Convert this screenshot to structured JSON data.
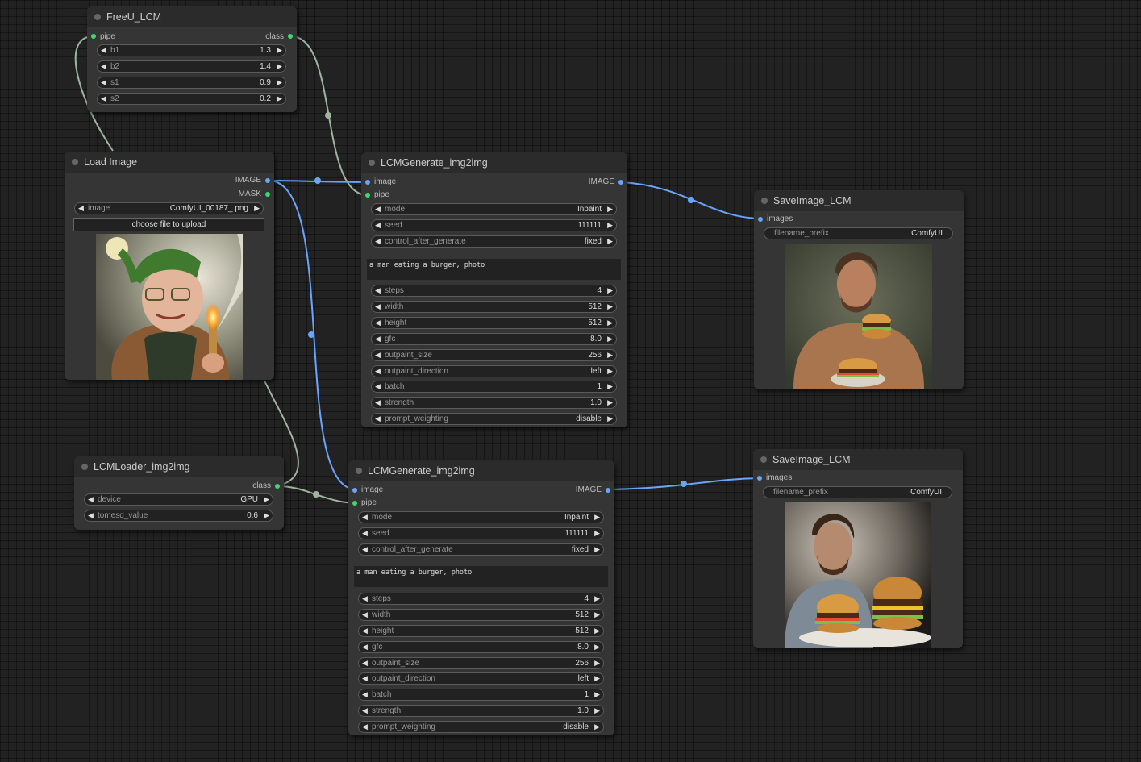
{
  "colors": {
    "image_link": "#69a4ff",
    "pipe_link": "#9fb5a0",
    "background": "#222222",
    "node": "#353535"
  },
  "freeu": {
    "title": "FreeU_LCM",
    "input_pipe": "pipe",
    "output_class": "class",
    "b1_label": "b1",
    "b1_value": "1.3",
    "b2_label": "b2",
    "b2_value": "1.4",
    "s1_label": "s1",
    "s1_value": "0.9",
    "s2_label": "s2",
    "s2_value": "0.2"
  },
  "load_image": {
    "title": "Load Image",
    "output_image": "IMAGE",
    "output_mask": "MASK",
    "image_label": "image",
    "image_value": "ComfyUI_00187_.png",
    "upload_label": "choose file to upload"
  },
  "loader": {
    "title": "LCMLoader_img2img",
    "output_class": "class",
    "device_label": "device",
    "device_value": "GPU",
    "tomesd_label": "tomesd_value",
    "tomesd_value": "0.6"
  },
  "gen1": {
    "title": "LCMGenerate_img2img",
    "input_image": "image",
    "input_pipe": "pipe",
    "output_image": "IMAGE",
    "mode_label": "mode",
    "mode_value": "Inpaint",
    "seed_label": "seed",
    "seed_value": "111111",
    "cag_label": "control_after_generate",
    "cag_value": "fixed",
    "prompt": "a man eating a burger, photo",
    "steps_label": "steps",
    "steps_value": "4",
    "width_label": "width",
    "width_value": "512",
    "height_label": "height",
    "height_value": "512",
    "gfc_label": "gfc",
    "gfc_value": "8.0",
    "osize_label": "outpaint_size",
    "osize_value": "256",
    "odir_label": "outpaint_direction",
    "odir_value": "left",
    "batch_label": "batch",
    "batch_value": "1",
    "strength_label": "strength",
    "strength_value": "1.0",
    "pw_label": "prompt_weighting",
    "pw_value": "disable"
  },
  "gen2": {
    "title": "LCMGenerate_img2img",
    "input_image": "image",
    "input_pipe": "pipe",
    "output_image": "IMAGE",
    "mode_label": "mode",
    "mode_value": "Inpaint",
    "seed_label": "seed",
    "seed_value": "111111",
    "cag_label": "control_after_generate",
    "cag_value": "fixed",
    "prompt": "a man eating a burger, photo",
    "steps_label": "steps",
    "steps_value": "4",
    "width_label": "width",
    "width_value": "512",
    "height_label": "height",
    "height_value": "512",
    "gfc_label": "gfc",
    "gfc_value": "8.0",
    "osize_label": "outpaint_size",
    "osize_value": "256",
    "odir_label": "outpaint_direction",
    "odir_value": "left",
    "batch_label": "batch",
    "batch_value": "1",
    "strength_label": "strength",
    "strength_value": "1.0",
    "pw_label": "prompt_weighting",
    "pw_value": "disable"
  },
  "save1": {
    "title": "SaveImage_LCM",
    "input_images": "images",
    "prefix_label": "filename_prefix",
    "prefix_value": "ComfyUI"
  },
  "save2": {
    "title": "SaveImage_LCM",
    "input_images": "images",
    "prefix_label": "filename_prefix",
    "prefix_value": "ComfyUI"
  }
}
